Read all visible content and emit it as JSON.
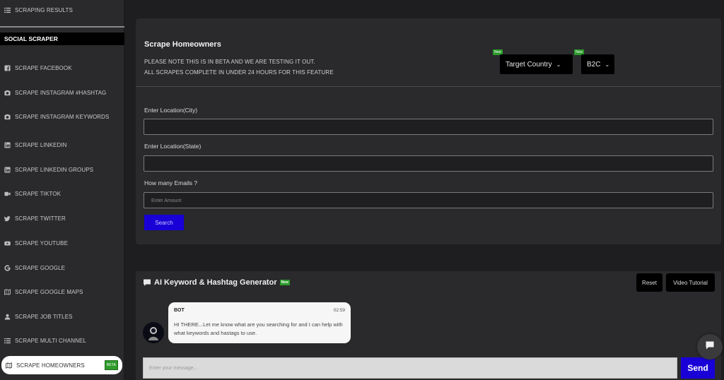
{
  "sidebar": {
    "top_item": {
      "label": "SCRAPING RESULTS",
      "icon": "list-icon"
    },
    "section_label": "SOCIAL SCRAPER",
    "items": [
      {
        "label": "SCRAPE FACEBOOK",
        "icon": "facebook-icon"
      },
      {
        "label": "SCRAPE INSTAGRAM #HASHTAG",
        "icon": "camera-icon"
      },
      {
        "label": "SCRAPE INSTAGRAM KEYWORDS",
        "icon": "camera-icon"
      },
      {
        "label": "SCRAPE LINKEDIN",
        "icon": "linkedin-icon"
      },
      {
        "label": "SCRAPE LINKEDIN GROUPS",
        "icon": "linkedin-icon"
      },
      {
        "label": "SCRAPE TIKTOK",
        "icon": "video-icon"
      },
      {
        "label": "SCRAPE TWITTER",
        "icon": "twitter-icon"
      },
      {
        "label": "SCRAPE YOUTUBE",
        "icon": "youtube-icon"
      },
      {
        "label": "SCRAPE GOOGLE",
        "icon": "google-icon"
      },
      {
        "label": "SCRAPE GOOGLE MAPS",
        "icon": "map-icon"
      },
      {
        "label": "SCRAPE JOB TITLES",
        "icon": "user-icon"
      },
      {
        "label": "SCRAPE MULTI CHANNEL",
        "icon": "list-icon"
      }
    ],
    "active_item": {
      "label": "SCRAPE HOMEOWNERS",
      "icon": "map-icon",
      "badge": "BETA"
    }
  },
  "scrape": {
    "title": "Scrape Homeowners",
    "note_line1": "PLEASE NOTE THIS IS IN BETA AND WE ARE TESTING IT OUT.",
    "note_line2": "ALL SCRAPES COMPLETE IN UNDER 24 HOURS FOR THIS FEATURE",
    "country_select": {
      "value": "Target Country",
      "badge": "New"
    },
    "type_select": {
      "value": "B2C",
      "badge": "New"
    },
    "city_label": "Enter Location(City)",
    "city_value": "",
    "state_label": "Enter Location(State)",
    "state_value": "",
    "emails_label": "How many Emails ?",
    "emails_placeholder": "Enter Amount",
    "search_label": "Search"
  },
  "chat": {
    "title": "AI Keyword & Hashtag Generator",
    "title_badge": "New",
    "reset_label": "Reset",
    "tutorial_label": "Video Tutorial",
    "bot_name": "BOT",
    "time": "02:59",
    "message": "HI THERE...Let me know what are you searching for and I can help with what keywords and hastags to use.",
    "input_placeholder": "Enter your message...",
    "send_label": "Send"
  },
  "colors": {
    "accent": "#1800d6",
    "badge_green": "#2a9a2a",
    "sidebar_bg": "#2a2a2c",
    "page_bg": "#1e1e20"
  }
}
